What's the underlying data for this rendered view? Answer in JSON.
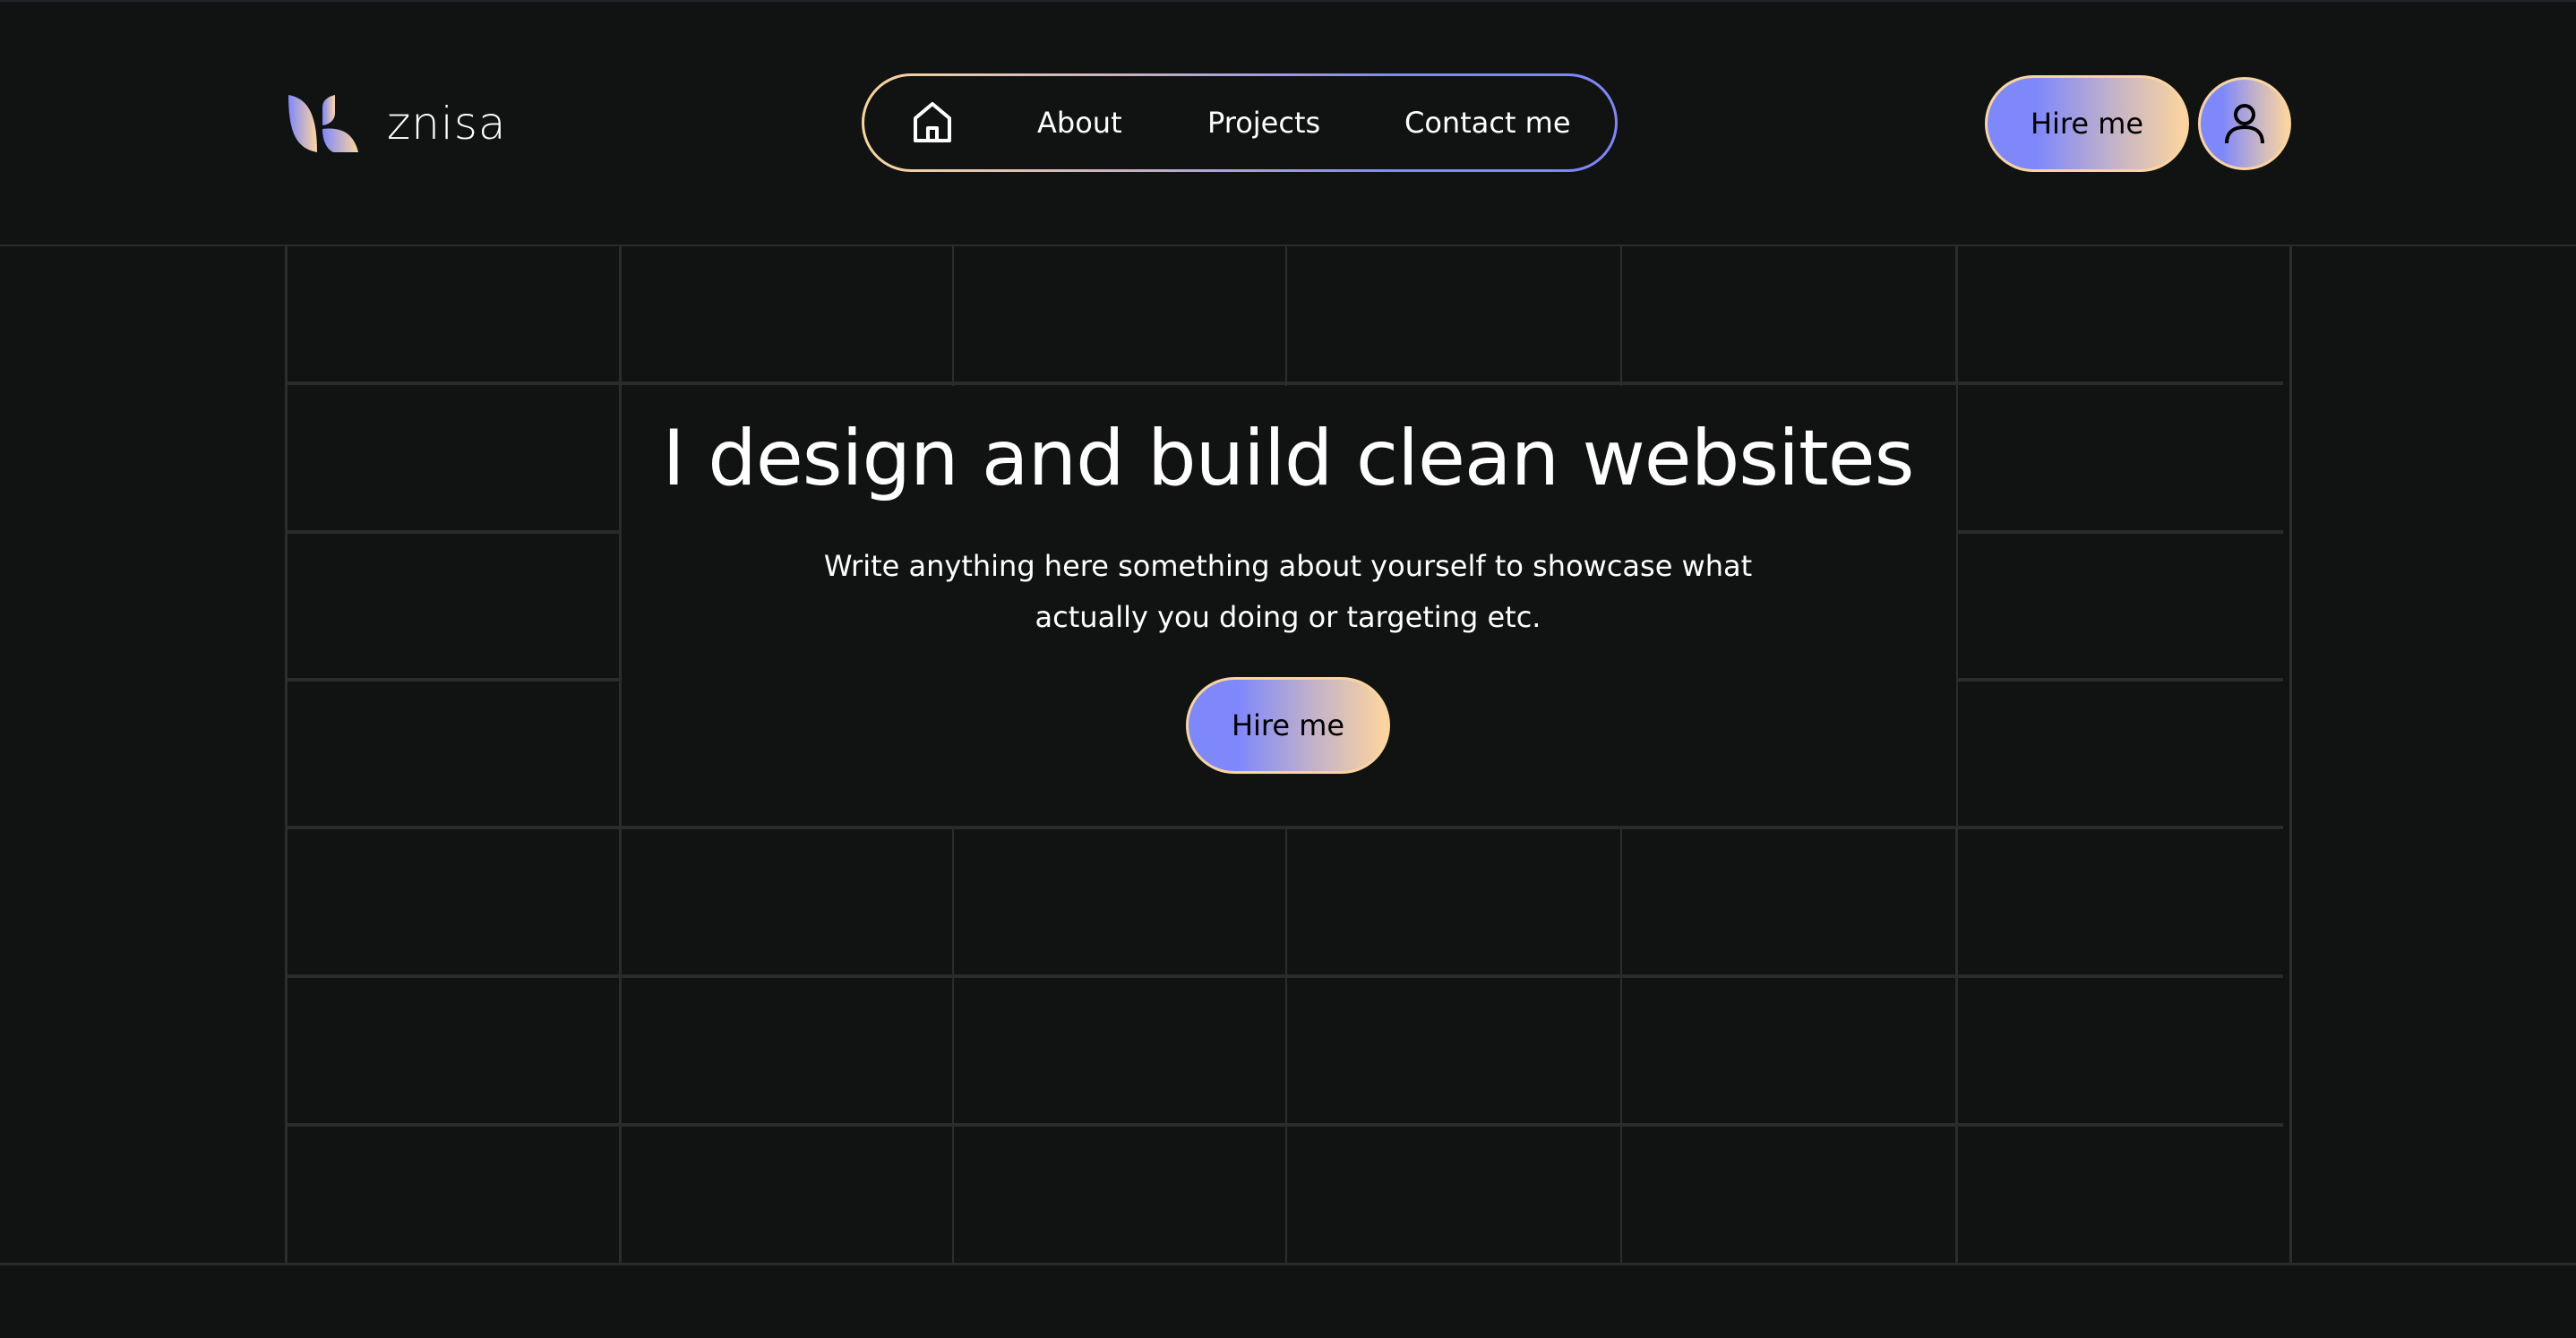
{
  "brand": {
    "name": "znisa",
    "logo_icon": "leaf-k-logo-icon"
  },
  "nav": {
    "home_icon": "home-icon",
    "links": [
      {
        "label": "About"
      },
      {
        "label": "Projects"
      },
      {
        "label": "Contact me"
      }
    ]
  },
  "header_actions": {
    "hire_label": "Hire me",
    "profile_icon": "user-icon"
  },
  "hero": {
    "title": "I design and build clean websites",
    "subtitle": "Write anything here something about yourself to showcase what actually you doing or targeting etc.",
    "cta_label": "Hire me"
  },
  "theme": {
    "background": "#111312",
    "gradient_start": "#7f88fb",
    "gradient_end": "#fdd59e",
    "grid_line": "#2a2c2c"
  }
}
